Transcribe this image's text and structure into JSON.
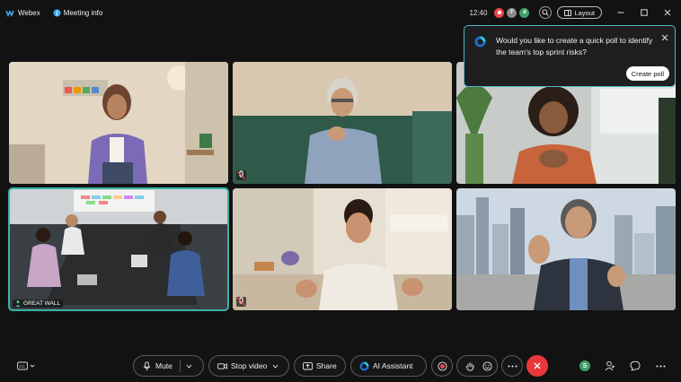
{
  "titlebar": {
    "app_name": "Webex",
    "meeting_info_label": "Meeting info",
    "clock": "12:40",
    "participants": [
      {
        "initial": "",
        "color": "#e8454a"
      },
      {
        "initial": "F",
        "color": "#8a8a8a"
      },
      {
        "initial": "d",
        "color": "#3fa06a"
      }
    ],
    "layout_label": "Layout"
  },
  "popup": {
    "message": "Would you like to create a quick poll to identify the team's top sprint risks?",
    "button_label": "Create poll"
  },
  "tiles": [
    {
      "id": "video-tile-1",
      "muted": false
    },
    {
      "id": "video-tile-2",
      "muted": true
    },
    {
      "id": "video-tile-3",
      "muted": false
    },
    {
      "id": "video-tile-4",
      "muted": false,
      "room_name": "GREAT WALL",
      "active_speaker": true
    },
    {
      "id": "video-tile-5",
      "muted": true
    },
    {
      "id": "video-tile-6",
      "muted": false
    }
  ],
  "toolbar": {
    "mute_label": "Mute",
    "stop_video_label": "Stop video",
    "share_label": "Share",
    "ai_assistant_label": "AI Assistant",
    "status_badge": "S"
  },
  "colors": {
    "accent_teal": "#3ab3a8",
    "popup_border": "#4fb8c8",
    "end_call": "#e8383d"
  }
}
